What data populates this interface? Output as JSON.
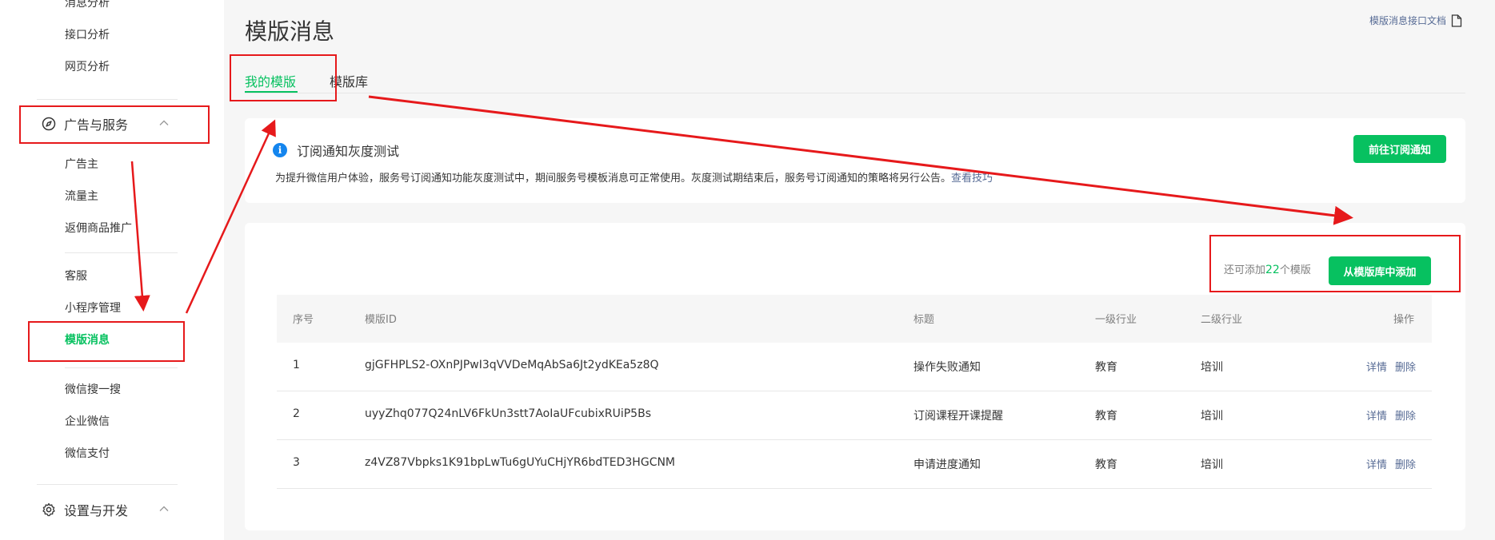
{
  "sidebar": {
    "items_top": [
      "消息分析",
      "接口分析",
      "网页分析"
    ],
    "group_ads": {
      "label": "广告与服务"
    },
    "items_ads": [
      "广告主",
      "流量主",
      "返佣商品推广"
    ],
    "items_service": [
      "客服",
      "小程序管理",
      "模版消息"
    ],
    "items_other": [
      "微信搜一搜",
      "企业微信",
      "微信支付"
    ],
    "group_settings": {
      "label": "设置与开发"
    }
  },
  "page": {
    "title": "模版消息",
    "doc_link": "模版消息接口文档"
  },
  "tabs": [
    "我的模版",
    "模版库"
  ],
  "notice": {
    "title": "订阅通知灰度测试",
    "body": "为提升微信用户体验，服务号订阅通知功能灰度测试中，期间服务号模板消息可正常使用。灰度测试期结束后，服务号订阅通知的策略将另行公告。",
    "link": "查看技巧",
    "button": "前往订阅通知"
  },
  "templates": {
    "quota_prefix": "还可添加",
    "quota_count": "22",
    "quota_suffix": "个模版",
    "add_button": "从模版库中添加",
    "columns": [
      "序号",
      "模版ID",
      "标题",
      "一级行业",
      "二级行业",
      "操作"
    ],
    "rows": [
      {
        "index": "1",
        "id": "gjGFHPLS2-OXnPJPwI3qVVDeMqAbSa6Jt2ydKEa5z8Q",
        "title": "操作失败通知",
        "industry1": "教育",
        "industry2": "培训",
        "detail": "详情",
        "delete": "删除"
      },
      {
        "index": "2",
        "id": "uyyZhq077Q24nLV6FkUn3stt7AoIaUFcubixRUiP5Bs",
        "title": "订阅课程开课提醒",
        "industry1": "教育",
        "industry2": "培训",
        "detail": "详情",
        "delete": "删除"
      },
      {
        "index": "3",
        "id": "z4VZ87Vbpks1K91bpLwTu6gUYuCHjYR6bdTED3HGCNM",
        "title": "申请进度通知",
        "industry1": "教育",
        "industry2": "培训",
        "detail": "详情",
        "delete": "删除"
      }
    ]
  },
  "colors": {
    "accent": "#07c160",
    "link": "#576b95",
    "annotation": "#e6191b"
  }
}
